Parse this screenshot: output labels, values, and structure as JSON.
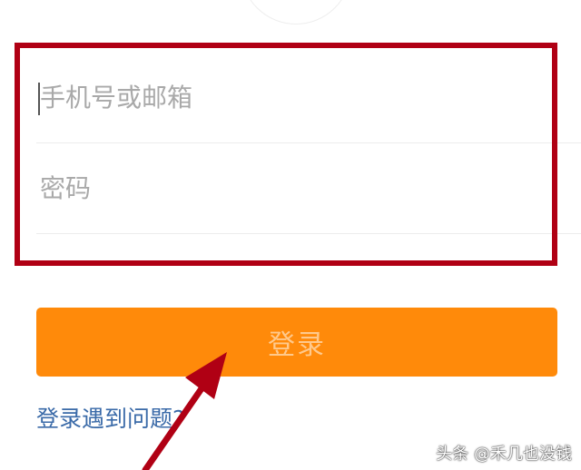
{
  "login_form": {
    "phone_placeholder": "手机号或邮箱",
    "password_placeholder": "密码",
    "login_button_label": "登录",
    "help_link_text": "登录遇到问题?"
  },
  "annotation": {
    "watermark_text": "头条 @禾几也没钱"
  },
  "colors": {
    "primary_button": "#ff8a0a",
    "button_text": "#ffc98c",
    "link": "#3a6aa8",
    "highlight_border": "#b00014",
    "arrow": "#b00014"
  }
}
